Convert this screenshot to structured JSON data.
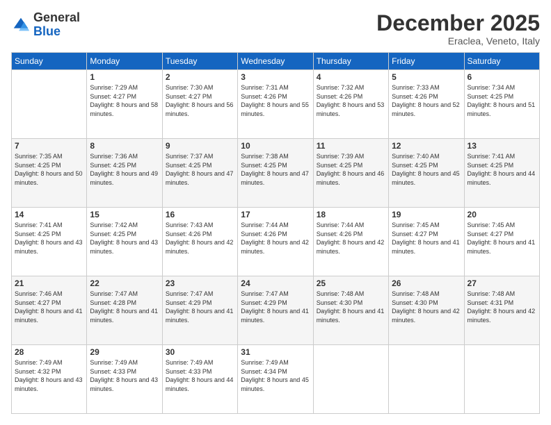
{
  "header": {
    "logo_general": "General",
    "logo_blue": "Blue",
    "month_title": "December 2025",
    "location": "Eraclea, Veneto, Italy"
  },
  "days_of_week": [
    "Sunday",
    "Monday",
    "Tuesday",
    "Wednesday",
    "Thursday",
    "Friday",
    "Saturday"
  ],
  "weeks": [
    [
      {
        "day": "",
        "sunrise": "",
        "sunset": "",
        "daylight": ""
      },
      {
        "day": "1",
        "sunrise": "Sunrise: 7:29 AM",
        "sunset": "Sunset: 4:27 PM",
        "daylight": "Daylight: 8 hours and 58 minutes."
      },
      {
        "day": "2",
        "sunrise": "Sunrise: 7:30 AM",
        "sunset": "Sunset: 4:27 PM",
        "daylight": "Daylight: 8 hours and 56 minutes."
      },
      {
        "day": "3",
        "sunrise": "Sunrise: 7:31 AM",
        "sunset": "Sunset: 4:26 PM",
        "daylight": "Daylight: 8 hours and 55 minutes."
      },
      {
        "day": "4",
        "sunrise": "Sunrise: 7:32 AM",
        "sunset": "Sunset: 4:26 PM",
        "daylight": "Daylight: 8 hours and 53 minutes."
      },
      {
        "day": "5",
        "sunrise": "Sunrise: 7:33 AM",
        "sunset": "Sunset: 4:26 PM",
        "daylight": "Daylight: 8 hours and 52 minutes."
      },
      {
        "day": "6",
        "sunrise": "Sunrise: 7:34 AM",
        "sunset": "Sunset: 4:25 PM",
        "daylight": "Daylight: 8 hours and 51 minutes."
      }
    ],
    [
      {
        "day": "7",
        "sunrise": "Sunrise: 7:35 AM",
        "sunset": "Sunset: 4:25 PM",
        "daylight": "Daylight: 8 hours and 50 minutes."
      },
      {
        "day": "8",
        "sunrise": "Sunrise: 7:36 AM",
        "sunset": "Sunset: 4:25 PM",
        "daylight": "Daylight: 8 hours and 49 minutes."
      },
      {
        "day": "9",
        "sunrise": "Sunrise: 7:37 AM",
        "sunset": "Sunset: 4:25 PM",
        "daylight": "Daylight: 8 hours and 47 minutes."
      },
      {
        "day": "10",
        "sunrise": "Sunrise: 7:38 AM",
        "sunset": "Sunset: 4:25 PM",
        "daylight": "Daylight: 8 hours and 47 minutes."
      },
      {
        "day": "11",
        "sunrise": "Sunrise: 7:39 AM",
        "sunset": "Sunset: 4:25 PM",
        "daylight": "Daylight: 8 hours and 46 minutes."
      },
      {
        "day": "12",
        "sunrise": "Sunrise: 7:40 AM",
        "sunset": "Sunset: 4:25 PM",
        "daylight": "Daylight: 8 hours and 45 minutes."
      },
      {
        "day": "13",
        "sunrise": "Sunrise: 7:41 AM",
        "sunset": "Sunset: 4:25 PM",
        "daylight": "Daylight: 8 hours and 44 minutes."
      }
    ],
    [
      {
        "day": "14",
        "sunrise": "Sunrise: 7:41 AM",
        "sunset": "Sunset: 4:25 PM",
        "daylight": "Daylight: 8 hours and 43 minutes."
      },
      {
        "day": "15",
        "sunrise": "Sunrise: 7:42 AM",
        "sunset": "Sunset: 4:25 PM",
        "daylight": "Daylight: 8 hours and 43 minutes."
      },
      {
        "day": "16",
        "sunrise": "Sunrise: 7:43 AM",
        "sunset": "Sunset: 4:26 PM",
        "daylight": "Daylight: 8 hours and 42 minutes."
      },
      {
        "day": "17",
        "sunrise": "Sunrise: 7:44 AM",
        "sunset": "Sunset: 4:26 PM",
        "daylight": "Daylight: 8 hours and 42 minutes."
      },
      {
        "day": "18",
        "sunrise": "Sunrise: 7:44 AM",
        "sunset": "Sunset: 4:26 PM",
        "daylight": "Daylight: 8 hours and 42 minutes."
      },
      {
        "day": "19",
        "sunrise": "Sunrise: 7:45 AM",
        "sunset": "Sunset: 4:27 PM",
        "daylight": "Daylight: 8 hours and 41 minutes."
      },
      {
        "day": "20",
        "sunrise": "Sunrise: 7:45 AM",
        "sunset": "Sunset: 4:27 PM",
        "daylight": "Daylight: 8 hours and 41 minutes."
      }
    ],
    [
      {
        "day": "21",
        "sunrise": "Sunrise: 7:46 AM",
        "sunset": "Sunset: 4:27 PM",
        "daylight": "Daylight: 8 hours and 41 minutes."
      },
      {
        "day": "22",
        "sunrise": "Sunrise: 7:47 AM",
        "sunset": "Sunset: 4:28 PM",
        "daylight": "Daylight: 8 hours and 41 minutes."
      },
      {
        "day": "23",
        "sunrise": "Sunrise: 7:47 AM",
        "sunset": "Sunset: 4:29 PM",
        "daylight": "Daylight: 8 hours and 41 minutes."
      },
      {
        "day": "24",
        "sunrise": "Sunrise: 7:47 AM",
        "sunset": "Sunset: 4:29 PM",
        "daylight": "Daylight: 8 hours and 41 minutes."
      },
      {
        "day": "25",
        "sunrise": "Sunrise: 7:48 AM",
        "sunset": "Sunset: 4:30 PM",
        "daylight": "Daylight: 8 hours and 41 minutes."
      },
      {
        "day": "26",
        "sunrise": "Sunrise: 7:48 AM",
        "sunset": "Sunset: 4:30 PM",
        "daylight": "Daylight: 8 hours and 42 minutes."
      },
      {
        "day": "27",
        "sunrise": "Sunrise: 7:48 AM",
        "sunset": "Sunset: 4:31 PM",
        "daylight": "Daylight: 8 hours and 42 minutes."
      }
    ],
    [
      {
        "day": "28",
        "sunrise": "Sunrise: 7:49 AM",
        "sunset": "Sunset: 4:32 PM",
        "daylight": "Daylight: 8 hours and 43 minutes."
      },
      {
        "day": "29",
        "sunrise": "Sunrise: 7:49 AM",
        "sunset": "Sunset: 4:33 PM",
        "daylight": "Daylight: 8 hours and 43 minutes."
      },
      {
        "day": "30",
        "sunrise": "Sunrise: 7:49 AM",
        "sunset": "Sunset: 4:33 PM",
        "daylight": "Daylight: 8 hours and 44 minutes."
      },
      {
        "day": "31",
        "sunrise": "Sunrise: 7:49 AM",
        "sunset": "Sunset: 4:34 PM",
        "daylight": "Daylight: 8 hours and 45 minutes."
      },
      {
        "day": "",
        "sunrise": "",
        "sunset": "",
        "daylight": ""
      },
      {
        "day": "",
        "sunrise": "",
        "sunset": "",
        "daylight": ""
      },
      {
        "day": "",
        "sunrise": "",
        "sunset": "",
        "daylight": ""
      }
    ]
  ]
}
